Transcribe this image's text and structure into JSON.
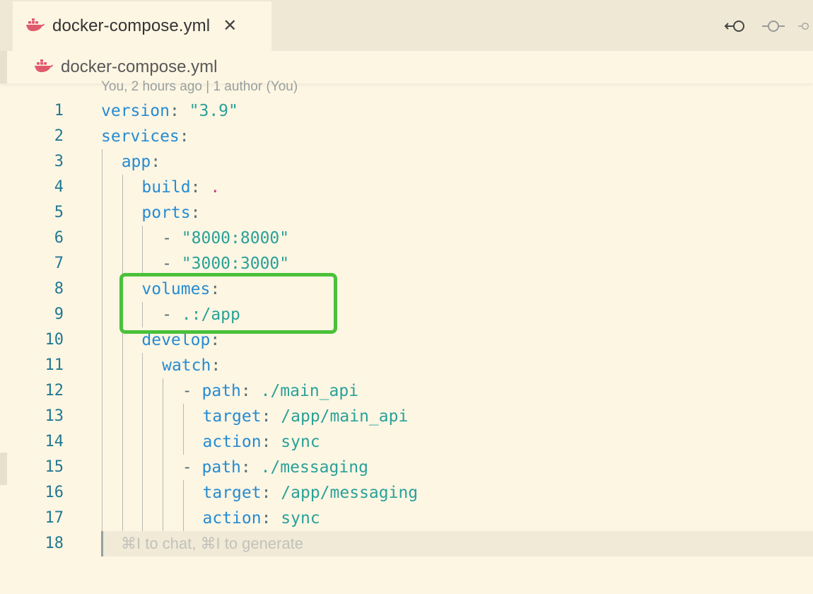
{
  "tab": {
    "label": "docker-compose.yml",
    "close": "✕"
  },
  "breadcrumb": {
    "label": "docker-compose.yml"
  },
  "blame": {
    "text": "You, 2 hours ago | 1 author (You)"
  },
  "lines": [
    {
      "num": "1",
      "indent": 0,
      "parts": [
        [
          "key",
          "version"
        ],
        [
          "pun",
          ": "
        ],
        [
          "str",
          "\"3.9\""
        ]
      ]
    },
    {
      "num": "2",
      "indent": 0,
      "parts": [
        [
          "key",
          "services"
        ],
        [
          "pun",
          ":"
        ]
      ]
    },
    {
      "num": "3",
      "indent": 1,
      "parts": [
        [
          "key",
          "app"
        ],
        [
          "pun",
          ":"
        ]
      ]
    },
    {
      "num": "4",
      "indent": 2,
      "parts": [
        [
          "key",
          "build"
        ],
        [
          "pun",
          ": "
        ],
        [
          "dot",
          "."
        ]
      ]
    },
    {
      "num": "5",
      "indent": 2,
      "parts": [
        [
          "key",
          "ports"
        ],
        [
          "pun",
          ":"
        ]
      ]
    },
    {
      "num": "6",
      "indent": 3,
      "parts": [
        [
          "pun",
          "- "
        ],
        [
          "str",
          "\"8000:8000\""
        ]
      ]
    },
    {
      "num": "7",
      "indent": 3,
      "parts": [
        [
          "pun",
          "- "
        ],
        [
          "str",
          "\"3000:3000\""
        ]
      ]
    },
    {
      "num": "8",
      "indent": 2,
      "parts": [
        [
          "key",
          "volumes"
        ],
        [
          "pun",
          ":"
        ]
      ]
    },
    {
      "num": "9",
      "indent": 3,
      "parts": [
        [
          "pun",
          "- "
        ],
        [
          "str",
          ".:/app"
        ]
      ]
    },
    {
      "num": "10",
      "indent": 2,
      "parts": [
        [
          "key",
          "develop"
        ],
        [
          "pun",
          ":"
        ]
      ]
    },
    {
      "num": "11",
      "indent": 3,
      "parts": [
        [
          "key",
          "watch"
        ],
        [
          "pun",
          ":"
        ]
      ]
    },
    {
      "num": "12",
      "indent": 4,
      "parts": [
        [
          "pun",
          "- "
        ],
        [
          "key",
          "path"
        ],
        [
          "pun",
          ": "
        ],
        [
          "str",
          "./main_api"
        ]
      ]
    },
    {
      "num": "13",
      "indent": 5,
      "parts": [
        [
          "key",
          "target"
        ],
        [
          "pun",
          ": "
        ],
        [
          "str",
          "/app/main_api"
        ]
      ]
    },
    {
      "num": "14",
      "indent": 5,
      "parts": [
        [
          "key",
          "action"
        ],
        [
          "pun",
          ": "
        ],
        [
          "str",
          "sync"
        ]
      ]
    },
    {
      "num": "15",
      "indent": 4,
      "parts": [
        [
          "pun",
          "- "
        ],
        [
          "key",
          "path"
        ],
        [
          "pun",
          ": "
        ],
        [
          "str",
          "./messaging"
        ]
      ]
    },
    {
      "num": "16",
      "indent": 5,
      "parts": [
        [
          "key",
          "target"
        ],
        [
          "pun",
          ": "
        ],
        [
          "str",
          "/app/messaging"
        ]
      ]
    },
    {
      "num": "17",
      "indent": 5,
      "parts": [
        [
          "key",
          "action"
        ],
        [
          "pun",
          ": "
        ],
        [
          "str",
          "sync"
        ]
      ]
    },
    {
      "num": "18",
      "indent": 0,
      "parts": []
    }
  ],
  "inline_hint": "⌘I to chat, ⌘I to generate",
  "colors": {
    "background": "#fdf6e3",
    "highlight": "#4ac13a",
    "docker": "#e05a6e"
  },
  "icons": [
    "docker-icon",
    "close-icon",
    "go-back-icon",
    "go-forward-icon",
    "commit-icon"
  ]
}
